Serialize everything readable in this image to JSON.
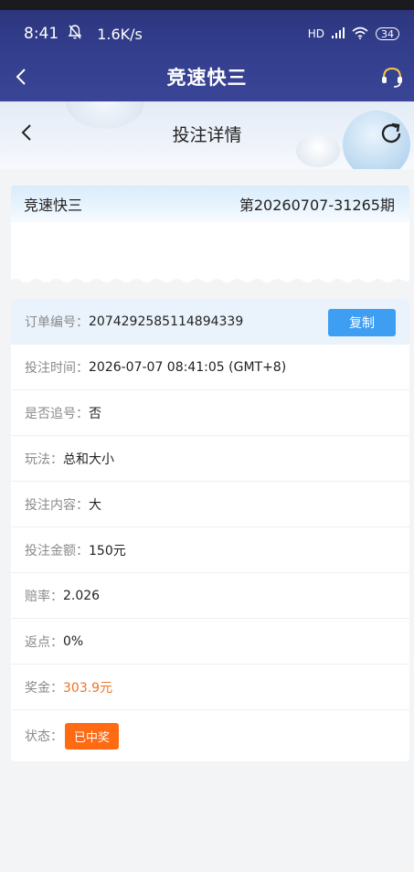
{
  "status_bar": {
    "time": "8:41",
    "speed": "1.6K/s",
    "network": "HD",
    "battery": "34"
  },
  "app_header": {
    "title": "竞速快三"
  },
  "sub_header": {
    "title": "投注详情"
  },
  "lottery_card": {
    "name": "竞速快三",
    "period": "第20260707-31265期"
  },
  "order": {
    "order_no_label": "订单编号：",
    "order_no": "2074292585114894339",
    "copy_label": "复制",
    "time_label": "投注时间：",
    "time": "2026-07-07 08:41:05 (GMT+8)",
    "chase_label": "是否追号：",
    "chase": "否",
    "play_label": "玩法：",
    "play": "总和大小",
    "content_label": "投注内容：",
    "content": "大",
    "amount_label": "投注金额：",
    "amount": "150元",
    "odds_label": "赔率：",
    "odds": "2.026",
    "rebate_label": "返点：",
    "rebate": "0%",
    "prize_label": "奖金：",
    "prize": "303.9元",
    "state_label": "状态：",
    "state": "已中奖"
  },
  "colors": {
    "header_bg": "#313c8a",
    "copy_button": "#3d9ef2",
    "prize_text": "#f07325",
    "status_badge": "#ff6a13"
  }
}
